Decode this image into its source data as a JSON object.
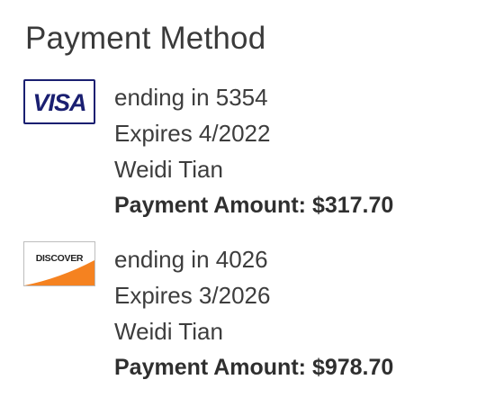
{
  "section_title": "Payment Method",
  "methods": [
    {
      "card_icon": "visa-icon",
      "logo_text": "VISA",
      "ending": "ending in 5354",
      "expires": "Expires 4/2022",
      "name": "Weidi Tian",
      "amount_label": "Payment Amount:",
      "amount_value": "$317.70"
    },
    {
      "card_icon": "discover-icon",
      "logo_text": "DISCOVER",
      "ending": "ending in 4026",
      "expires": "Expires 3/2026",
      "name": "Weidi Tian",
      "amount_label": "Payment Amount:",
      "amount_value": "$978.70"
    }
  ],
  "colors": {
    "visa_blue": "#1a1f71",
    "discover_orange": "#f58220",
    "text": "#3d3d3d"
  }
}
